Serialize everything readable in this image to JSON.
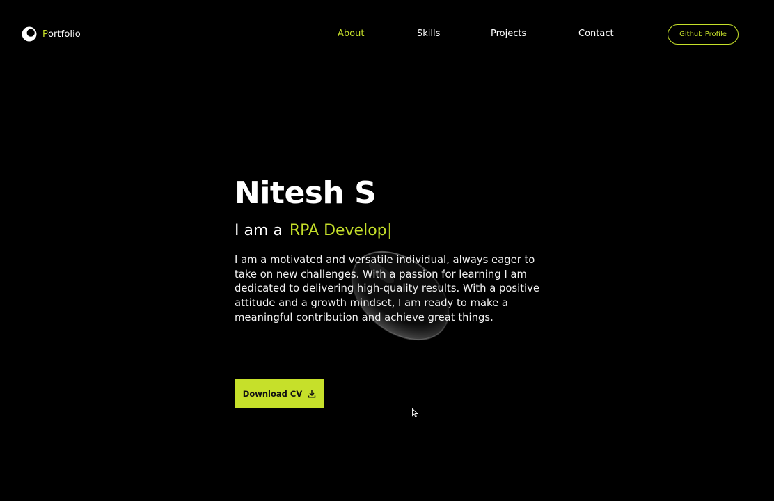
{
  "logo": {
    "first_letter": "P",
    "rest": "ortfolio",
    "icon": "half-moon-logo-icon"
  },
  "nav": {
    "items": [
      {
        "label": "About",
        "active": true
      },
      {
        "label": "Skills",
        "active": false
      },
      {
        "label": "Projects",
        "active": false
      },
      {
        "label": "Contact",
        "active": false
      }
    ],
    "github_button": "Github Profile"
  },
  "hero": {
    "name": "Nitesh S",
    "role_prefix": "I am a",
    "role_typed": "RPA Develop",
    "caret": "|",
    "description": "I am a motivated and versatile individual, always eager to take on new challenges. With a passion for learning I am dedicated to delivering high-quality results. With a positive attitude and a growth mindset, I am ready to make a meaningful contribution and achieve great things.",
    "cv_button": "Download CV",
    "cv_icon": "download-icon"
  },
  "colors": {
    "accent": "#c6e02a",
    "background": "#000000",
    "text": "#ffffff"
  }
}
